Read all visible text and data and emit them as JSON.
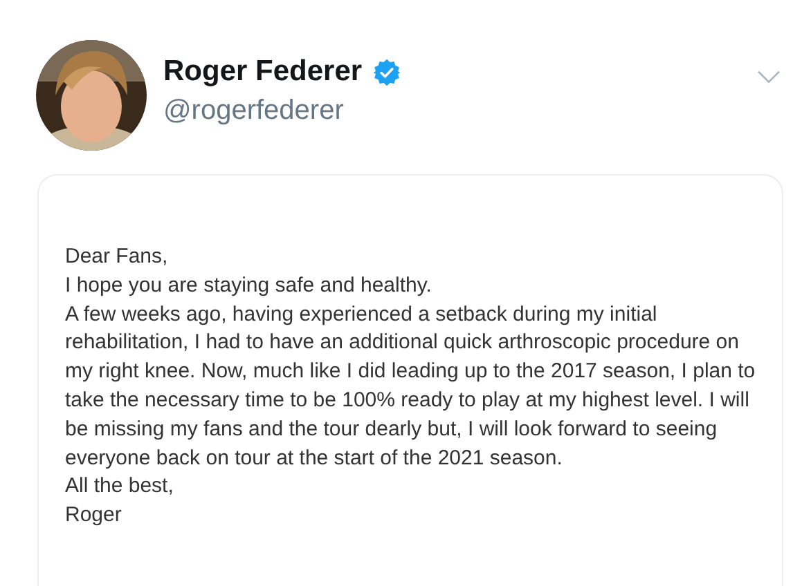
{
  "author": {
    "name": "Roger Federer",
    "handle": "@rogerfederer",
    "verified": true
  },
  "letter": {
    "paragraphs": [
      "Dear Fans,",
      "I hope you are staying safe and healthy.",
      "A few weeks ago, having experienced a setback during my initial rehabilitation, I had to have an additional quick arthroscopic procedure on my right knee. Now, much like I did leading up to the 2017 season, I plan to take the necessary time to be 100% ready to play at my highest level. I will be missing my fans and the tour dearly but, I will look forward to seeing everyone back on tour at the start of the 2021 season.",
      "All the best,",
      "Roger"
    ]
  }
}
